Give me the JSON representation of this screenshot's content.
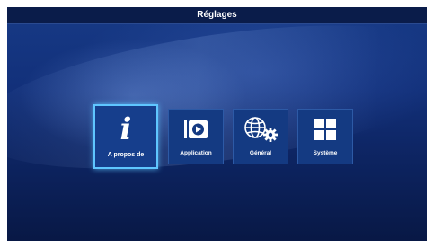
{
  "header": {
    "title": "Réglages"
  },
  "tiles": [
    {
      "label": "A propos de",
      "icon": "info-icon",
      "selected": true
    },
    {
      "label": "Application",
      "icon": "media-play-icon",
      "selected": false
    },
    {
      "label": "Général",
      "icon": "globe-gear-icon",
      "selected": false
    },
    {
      "label": "Système",
      "icon": "grid-icon",
      "selected": false
    }
  ],
  "colors": {
    "background": "#12307a",
    "tile": "#143a82",
    "selection_border": "#5fc6ff",
    "text": "#ffffff"
  }
}
